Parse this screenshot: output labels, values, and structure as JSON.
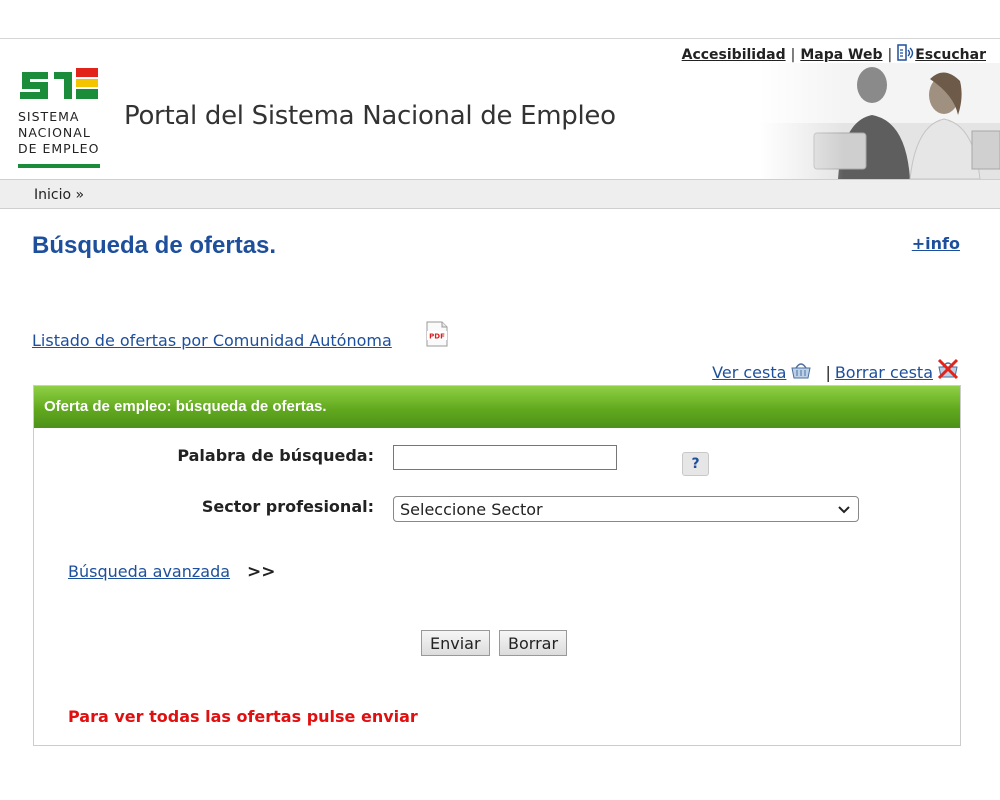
{
  "header": {
    "util_links": {
      "accessibility": "Accesibilidad",
      "sitemap": "Mapa Web",
      "listen": "Escuchar",
      "separator": "|"
    },
    "logo": {
      "line1": "SISTEMA",
      "line2": "NACIONAL",
      "line3": "DE EMPLEO",
      "colors": {
        "green": "#1a8c3a",
        "yellow": "#f5c400",
        "red": "#e2231a"
      }
    },
    "portal_title": "Portal del Sistema Nacional de Empleo"
  },
  "breadcrumb": {
    "home": "Inicio",
    "separator": "»"
  },
  "main": {
    "page_title": "Búsqueda de ofertas.",
    "plus_info": "+info",
    "listado_link": "Listado de ofertas por Comunidad Autónoma",
    "pdf_icon_label": "PDF",
    "basket": {
      "view": "Ver cesta",
      "separator": "|",
      "clear": "Borrar cesta"
    }
  },
  "form": {
    "panel_title": "Oferta de empleo: búsqueda de ofertas.",
    "keyword_label": "Palabra de búsqueda:",
    "keyword_value": "",
    "help_label": "?",
    "sector_label": "Sector profesional:",
    "sector_selected": "Seleccione Sector",
    "advanced_link": "Búsqueda avanzada ",
    "advanced_arrows": ">>",
    "submit_label": "Enviar",
    "reset_label": "Borrar",
    "note": "Para ver todas las ofertas pulse enviar"
  },
  "colors": {
    "link_blue": "#1d4f9c",
    "panel_green": "#62a91f",
    "note_red": "#e01010"
  }
}
